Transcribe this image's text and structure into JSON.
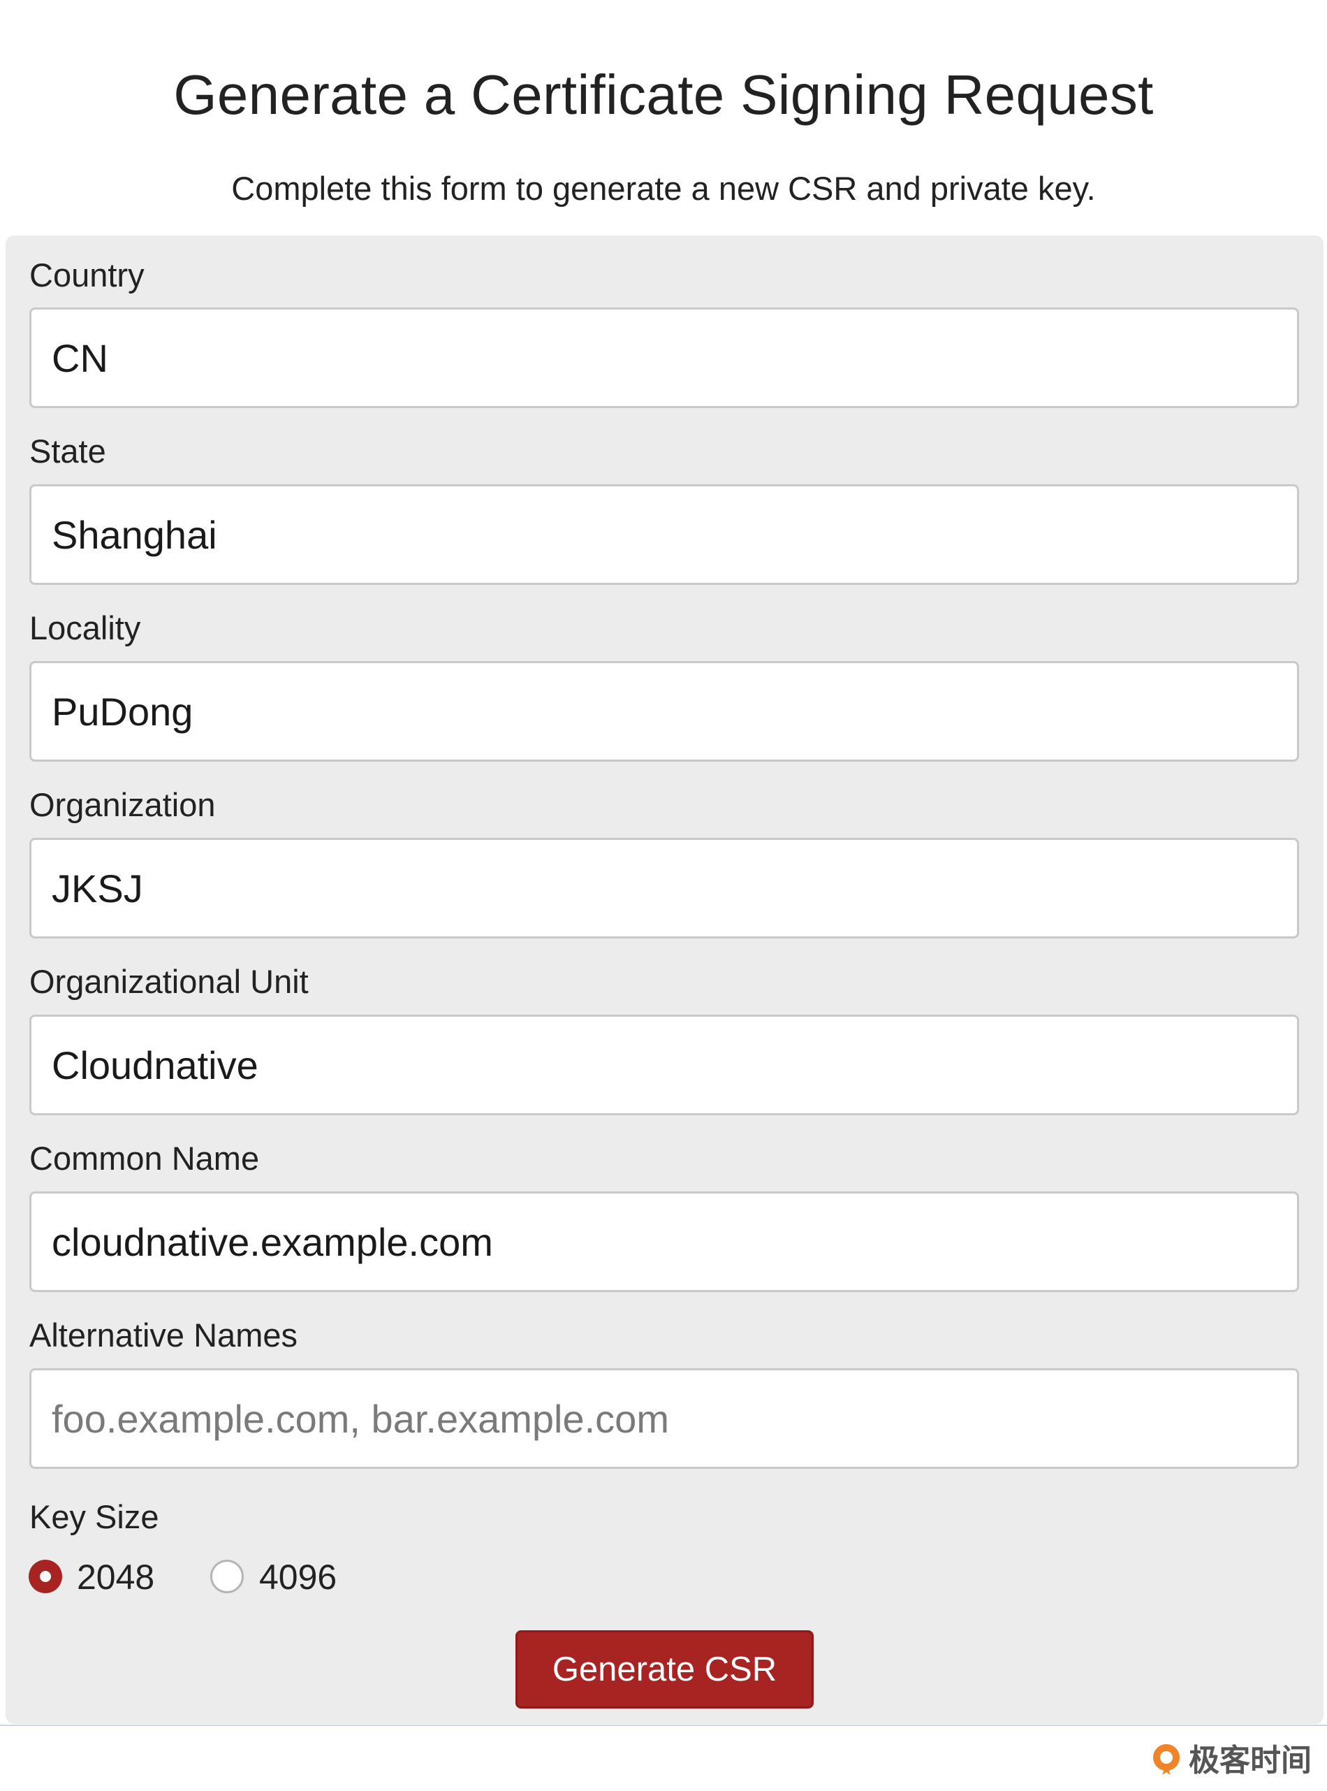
{
  "header": {
    "title": "Generate a Certificate Signing Request",
    "subtitle": "Complete this form to generate a new CSR and private key."
  },
  "form": {
    "fields": [
      {
        "label": "Country",
        "value": "CN",
        "placeholder": ""
      },
      {
        "label": "State",
        "value": "Shanghai",
        "placeholder": ""
      },
      {
        "label": "Locality",
        "value": "PuDong",
        "placeholder": ""
      },
      {
        "label": "Organization",
        "value": "JKSJ",
        "placeholder": ""
      },
      {
        "label": "Organizational Unit",
        "value": "Cloudnative",
        "placeholder": ""
      },
      {
        "label": "Common Name",
        "value": "cloudnative.example.com",
        "placeholder": ""
      },
      {
        "label": "Alternative Names",
        "value": "",
        "placeholder": "foo.example.com, bar.example.com"
      }
    ],
    "key_size": {
      "label": "Key Size",
      "options": [
        {
          "label": "2048",
          "checked": true
        },
        {
          "label": "4096",
          "checked": false
        }
      ]
    },
    "submit_label": "Generate CSR"
  },
  "watermark": {
    "text": "极客时间"
  },
  "colors": {
    "accent": "#a82422",
    "panel_bg": "#ececec",
    "input_border": "#c9c9c9",
    "divider": "#cbd6e3"
  }
}
